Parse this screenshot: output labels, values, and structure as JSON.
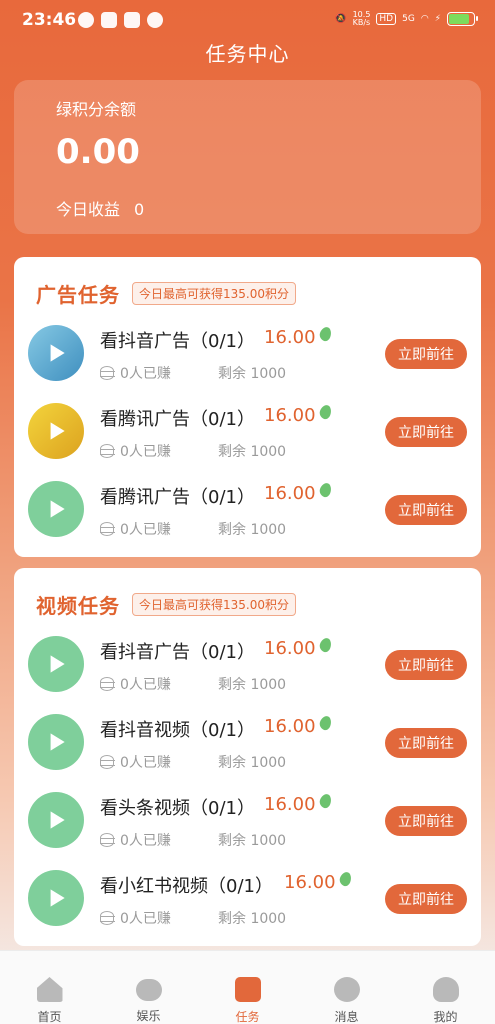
{
  "status_bar": {
    "time": "23:46",
    "net_speed": "10.5\nKB/s",
    "hd": "HD",
    "network": "5G"
  },
  "title": "任务中心",
  "balance": {
    "label": "绿积分余额",
    "amount": "0.00",
    "today_label": "今日收益",
    "today_value": "0"
  },
  "sections": [
    {
      "title": "广告任务",
      "badge": "今日最高可获得135.00积分",
      "tasks": [
        {
          "name": "看抖音广告（0/1）",
          "reward": "16.00",
          "earned": "0人已赚",
          "remain": "剩余 1000",
          "button": "立即前往",
          "icon_color": "blue"
        },
        {
          "name": "看腾讯广告（0/1）",
          "reward": "16.00",
          "earned": "0人已赚",
          "remain": "剩余 1000",
          "button": "立即前往",
          "icon_color": "yellow"
        },
        {
          "name": "看腾讯广告（0/1）",
          "reward": "16.00",
          "earned": "0人已赚",
          "remain": "剩余 1000",
          "button": "立即前往",
          "icon_color": "green"
        }
      ]
    },
    {
      "title": "视频任务",
      "badge": "今日最高可获得135.00积分",
      "tasks": [
        {
          "name": "看抖音广告（0/1）",
          "reward": "16.00",
          "earned": "0人已赚",
          "remain": "剩余 1000",
          "button": "立即前往",
          "icon_color": "green"
        },
        {
          "name": "看抖音视频（0/1）",
          "reward": "16.00",
          "earned": "0人已赚",
          "remain": "剩余 1000",
          "button": "立即前往",
          "icon_color": "green"
        },
        {
          "name": "看头条视频（0/1）",
          "reward": "16.00",
          "earned": "0人已赚",
          "remain": "剩余 1000",
          "button": "立即前往",
          "icon_color": "green"
        },
        {
          "name": "看小红书视频（0/1）",
          "reward": "16.00",
          "earned": "0人已赚",
          "remain": "剩余 1000",
          "button": "立即前往",
          "icon_color": "green"
        }
      ]
    }
  ],
  "tabs": [
    {
      "label": "首页",
      "icon": "home-icon"
    },
    {
      "label": "娱乐",
      "icon": "gamepad-icon"
    },
    {
      "label": "任务",
      "icon": "task-icon",
      "active": true
    },
    {
      "label": "消息",
      "icon": "message-icon"
    },
    {
      "label": "我的",
      "icon": "user-icon"
    }
  ],
  "colors": {
    "accent": "#e2683b",
    "reward": "#e0632f",
    "bean": "#6cc26e"
  }
}
